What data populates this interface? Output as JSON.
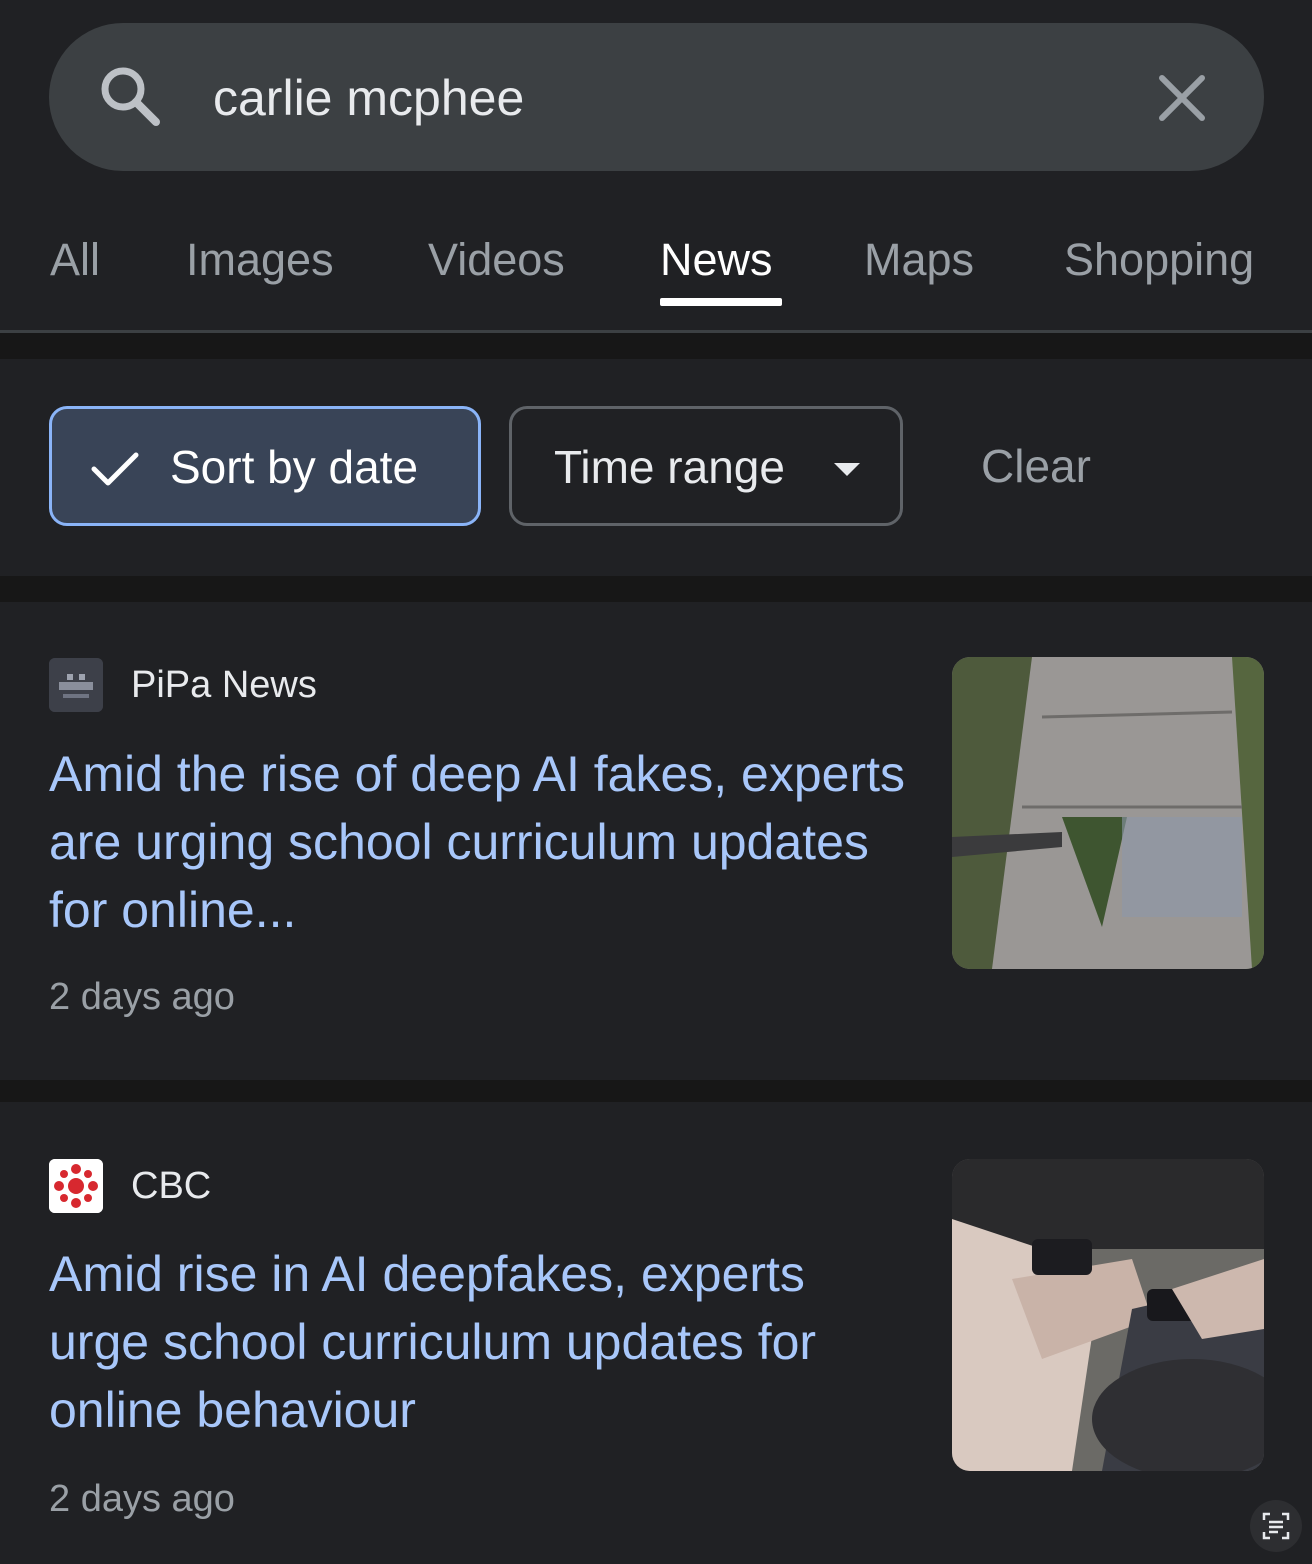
{
  "search": {
    "query": "carlie mcphee"
  },
  "tabs": [
    {
      "label": "All",
      "active": false
    },
    {
      "label": "Images",
      "active": false
    },
    {
      "label": "Videos",
      "active": false
    },
    {
      "label": "News",
      "active": true
    },
    {
      "label": "Maps",
      "active": false
    },
    {
      "label": "Shopping",
      "active": false
    }
  ],
  "filters": {
    "sort_label": "Sort by date",
    "sort_selected": true,
    "time_range_label": "Time range",
    "clear_label": "Clear"
  },
  "results": [
    {
      "source": "PiPa News",
      "headline": "Amid the rise of deep AI fakes, experts are urging school curriculum updates for online...",
      "time": "2 days ago",
      "thumbnail": "sidewalk-photo"
    },
    {
      "source": "CBC",
      "headline": "Amid rise in AI deepfakes, experts urge school curriculum updates for online behaviour",
      "time": "2 days ago",
      "thumbnail": "teens-phones-photo"
    }
  ],
  "colors": {
    "background": "#202124",
    "link": "#a8c7fa",
    "chip_selected_bg": "#394457",
    "chip_selected_border": "#8ab4f8",
    "cbc_red": "#d7282f"
  }
}
